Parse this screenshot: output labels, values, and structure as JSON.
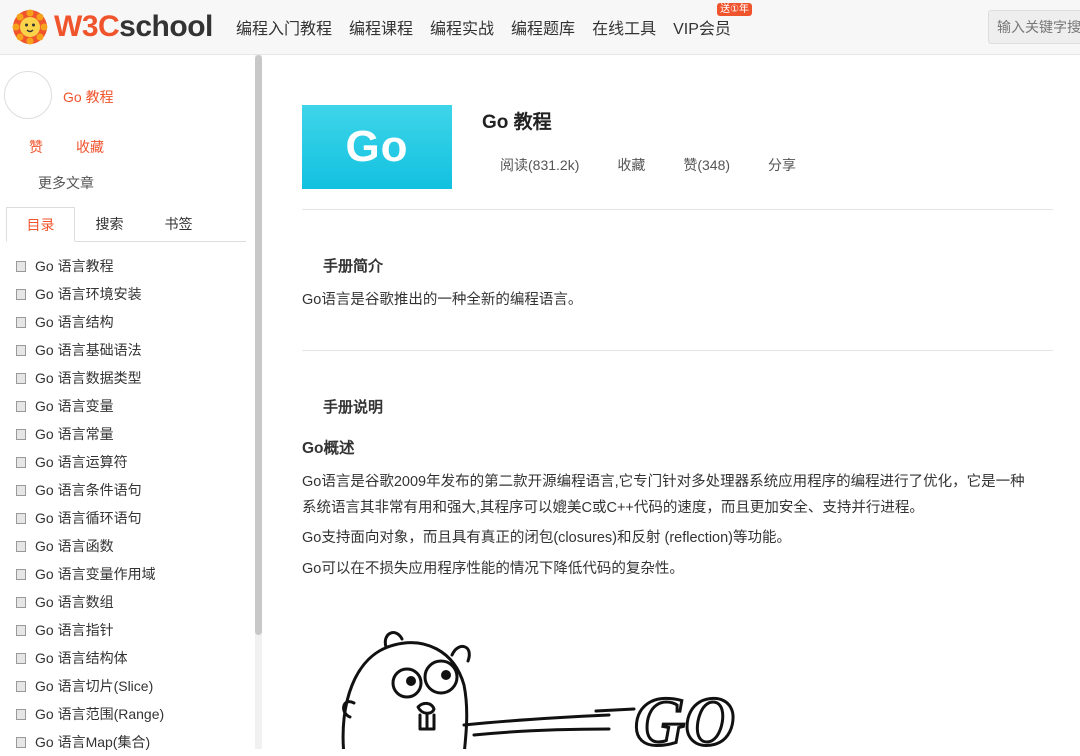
{
  "header": {
    "logo_text_prefix": "W3C",
    "logo_text_suffix": "school",
    "nav": [
      {
        "label": "编程入门教程"
      },
      {
        "label": "编程课程"
      },
      {
        "label": "编程实战"
      },
      {
        "label": "编程题库"
      },
      {
        "label": "在线工具"
      },
      {
        "label": "VIP会员",
        "badge": "送①年"
      }
    ],
    "search_placeholder": "输入关键字搜"
  },
  "sidebar": {
    "title": "Go 教程",
    "like_label": "赞",
    "favorite_label": "收藏",
    "more_label": "更多文章",
    "tabs": [
      {
        "label": "目录",
        "active": true
      },
      {
        "label": "搜索",
        "active": false
      },
      {
        "label": "书签",
        "active": false
      }
    ],
    "toc": [
      "Go 语言教程",
      "Go 语言环境安装",
      "Go 语言结构",
      "Go 语言基础语法",
      "Go 语言数据类型",
      "Go 语言变量",
      "Go 语言常量",
      "Go 语言运算符",
      "Go 语言条件语句",
      "Go 语言循环语句",
      "Go 语言函数",
      "Go 语言变量作用域",
      "Go 语言数组",
      "Go 语言指针",
      "Go 语言结构体",
      "Go 语言切片(Slice)",
      "Go 语言范围(Range)",
      "Go 语言Map(集合)"
    ]
  },
  "main": {
    "cover_text": "Go",
    "title": "Go 教程",
    "stats": {
      "reads": "阅读(831.2k)",
      "favorite": "收藏",
      "likes": "赞(348)",
      "share": "分享"
    },
    "intro_heading": "手册简介",
    "intro_text": "Go语言是谷歌推出的一种全新的编程语言。",
    "manual_heading": "手册说明",
    "overview_heading": "Go概述",
    "overview_p1_line1": "Go语言是谷歌2009年发布的第二款开源编程语言,它专门针对多处理器系统应用程序的编程进行了优化，它是一种",
    "overview_p1_line2": "系统语言其非常有用和强大,其程序可以媲美C或C++代码的速度，而且更加安全、支持并行进程。",
    "overview_p2": "Go支持面向对象，而且具有真正的闭包(closures)和反射 (reflection)等功能。",
    "overview_p3": "Go可以在不损失应用程序性能的情况下降低代码的复杂性。",
    "illustration_text": "GO"
  },
  "colors": {
    "accent": "#f0542d",
    "cover_bg": "#12c1e0"
  }
}
